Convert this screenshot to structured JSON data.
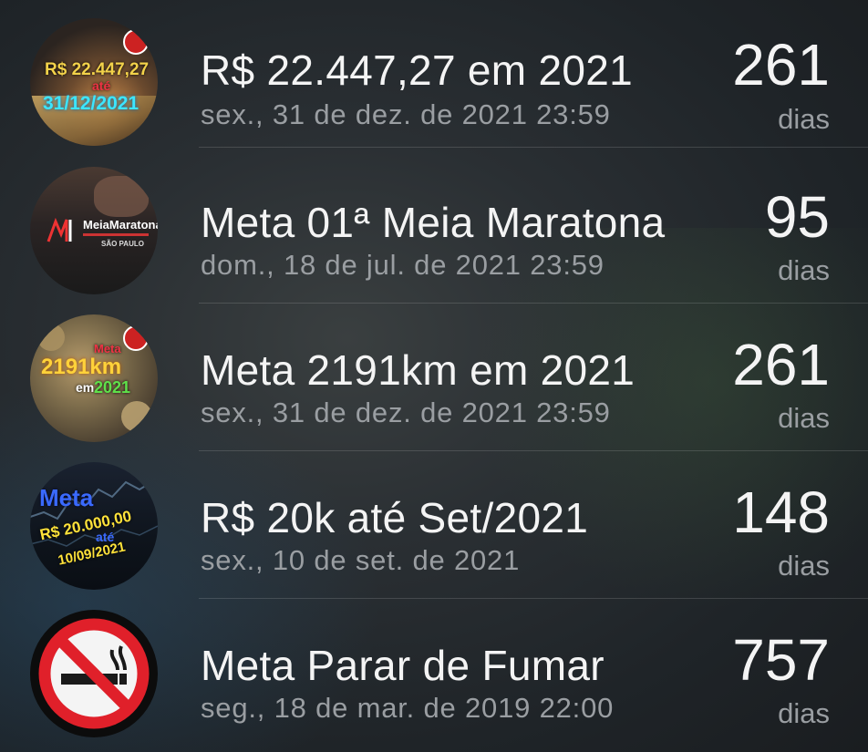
{
  "goals": [
    {
      "title": "R$ 22.447,27 em 2021",
      "date": "sex., 31 de dez. de 2021 23:59",
      "count": "261",
      "unit": "dias",
      "image": {
        "line1": "R$ 22.447,27",
        "line2": "até",
        "line3": "31/12/2021"
      }
    },
    {
      "title": "Meta 01ª Meia Maratona",
      "date": "dom., 18 de jul. de 2021 23:59",
      "count": "95",
      "unit": "dias",
      "image": {
        "line1": "MeiaMaratona",
        "line2": "SÃO PAULO"
      }
    },
    {
      "title": "Meta 2191km em 2021",
      "date": "sex., 31 de dez. de 2021 23:59",
      "count": "261",
      "unit": "dias",
      "image": {
        "line1": "Meta",
        "line2": "2191km",
        "line3": "em",
        "line4": "2021"
      }
    },
    {
      "title": "R$ 20k até Set/2021",
      "date": "sex., 10 de set. de 2021",
      "count": "148",
      "unit": "dias",
      "image": {
        "line1": "Meta",
        "line2": "R$ 20.000,00",
        "line3": "até",
        "line4": "10/09/2021"
      }
    },
    {
      "title": "Meta Parar de Fumar",
      "date": "seg., 18 de mar. de 2019 22:00",
      "count": "757",
      "unit": "dias",
      "image": {
        "icon": "no-smoking-icon"
      }
    }
  ]
}
